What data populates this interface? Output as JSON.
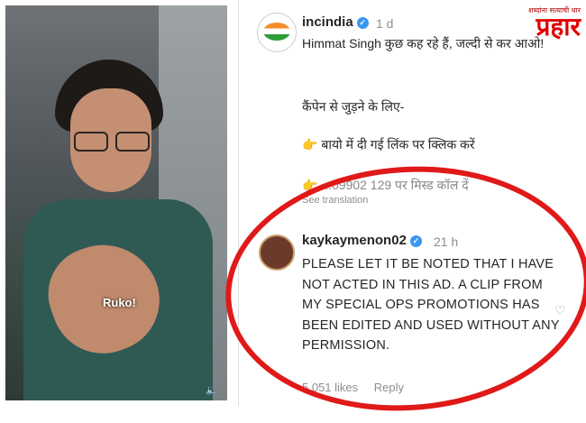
{
  "video": {
    "caption": "Ruko!",
    "mute_icon": "speaker-icon"
  },
  "post": {
    "comment1": {
      "username": "incindia",
      "time": "1 d",
      "line1": "Himmat Singh कुछ कह रहे हैं, जल्दी से कर आओ!",
      "line2": "कैंपेन से जुड़ने के लिए-",
      "line3": "👉 बायो में दी गई लिंक पर क्लिक करें",
      "line4": "👉 ...09902 129 पर मिस्ड कॉल दें",
      "translation": "See translation"
    },
    "comment2": {
      "username": "kaykaymenon02",
      "time": "21 h",
      "text": "PLEASE LET IT BE NOTED THAT I HAVE NOT ACTED IN THIS AD. A CLIP FROM MY SPECIAL OPS PROMOTIONS HAS BEEN EDITED AND USED WITHOUT ANY PERMISSION.",
      "likes": "5,051 likes",
      "reply": "Reply"
    }
  },
  "logo": {
    "tagline": "शब्दांना सत्याची धार",
    "brand": "प्रहार"
  },
  "colors": {
    "highlight_ring": "#e01919",
    "verified": "#3897f0",
    "brand": "#e00000"
  }
}
